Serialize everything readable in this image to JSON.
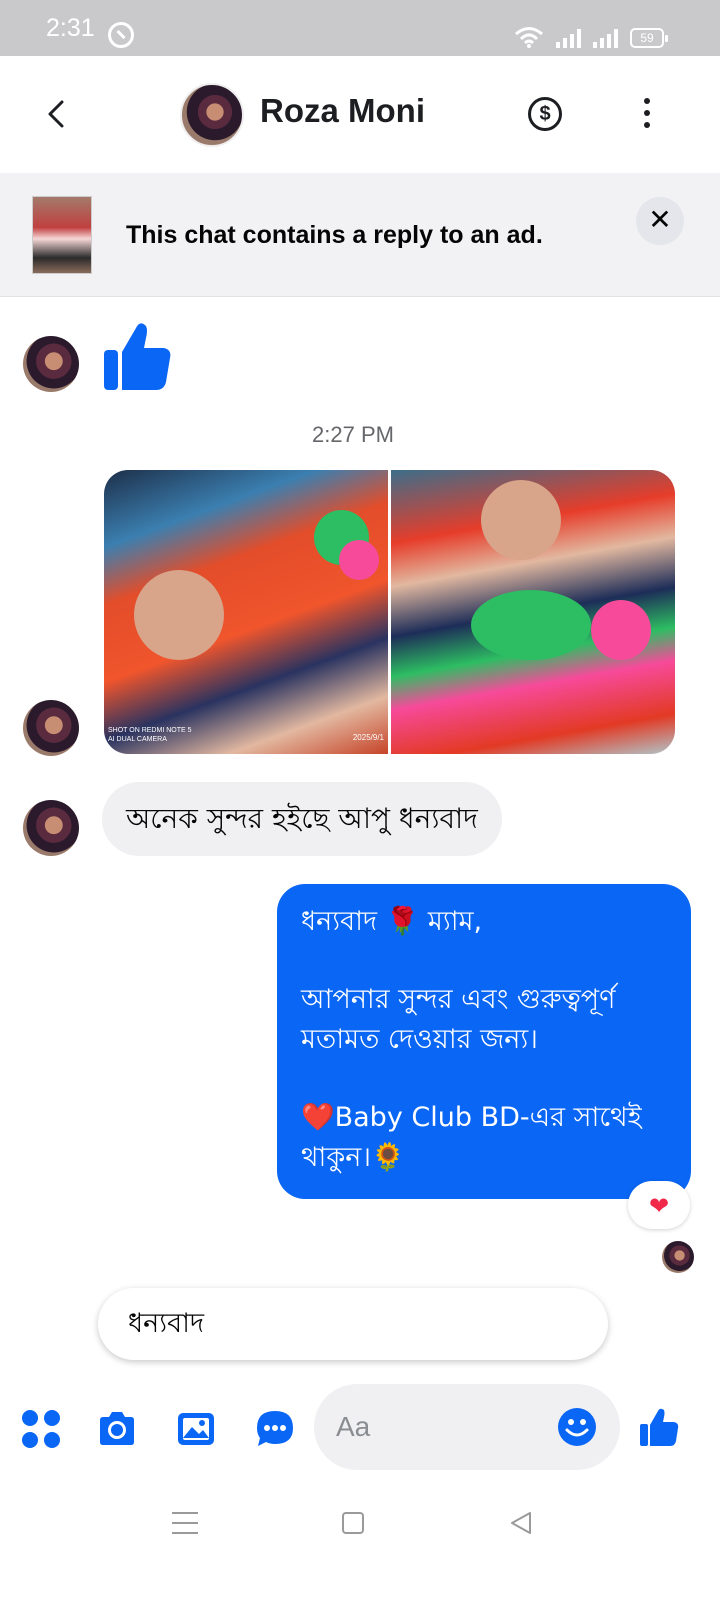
{
  "status_bar": {
    "time": "2:31",
    "battery": "59"
  },
  "header": {
    "contact_name": "Roza Moni"
  },
  "ad_banner": {
    "text": "This chat contains a reply to an ad.",
    "close_glyph": "✕"
  },
  "messages": {
    "timestamp": "2:27 PM",
    "photos": [
      {
        "watermark": "SHOT ON REDMI NOTE 5\nAI DUAL CAMERA",
        "date": "2025/9/1"
      },
      {
        "watermark": "",
        "date": ""
      }
    ],
    "incoming_text": "অনেক সুন্দর হইছে আপু ধন্যবাদ",
    "outgoing": {
      "line1": "ধন্যবাদ 🌹 ম্যাম,",
      "line2": "আপনার সুন্দর এবং গুরুত্বপূর্ণ মতামত দেওয়ার জন্য।",
      "line3": "❤️Baby Club BD-এর সাথেই থাকুন।🌻"
    },
    "reaction": "❤"
  },
  "quick_reply": {
    "text": "ধন্যবাদ"
  },
  "composer": {
    "placeholder": "Aa"
  },
  "icons": {
    "back": "chevron-left-icon",
    "money": "dollar-icon",
    "more": "more-vertical-icon",
    "apps": "apps-grid-icon",
    "camera": "camera-icon",
    "gallery": "image-icon",
    "chat": "chat-bubble-icon",
    "emoji": "smiley-icon",
    "like": "thumbs-up-icon"
  },
  "colors": {
    "accent": "#0a66f5",
    "incoming_bubble": "#f0f0f2",
    "reaction": "#f0284a"
  }
}
